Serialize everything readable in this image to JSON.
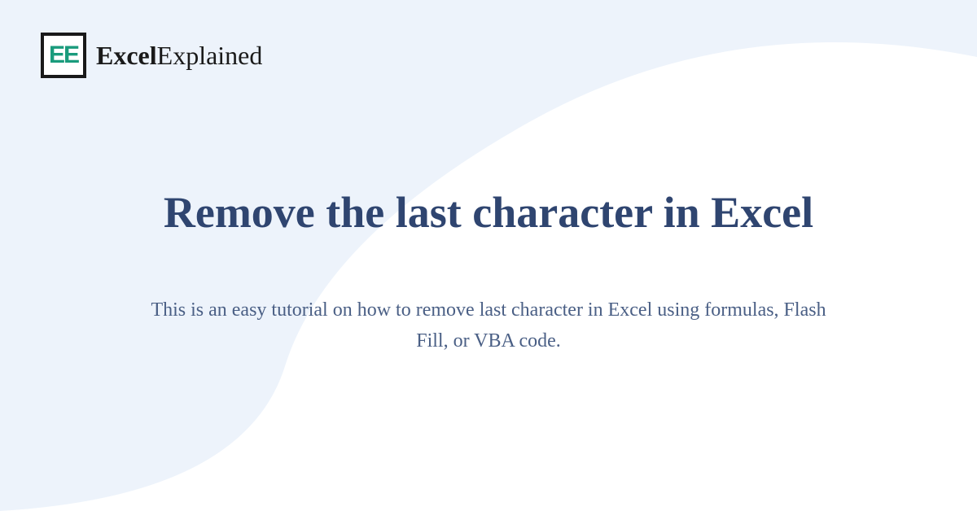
{
  "logo": {
    "icon_text": "EE",
    "brand_bold": "Excel",
    "brand_regular": "Explained"
  },
  "page": {
    "title": "Remove the last character in Excel",
    "subtitle": "This is an easy tutorial on how to remove last character in Excel using formulas, Flash Fill, or VBA code."
  }
}
